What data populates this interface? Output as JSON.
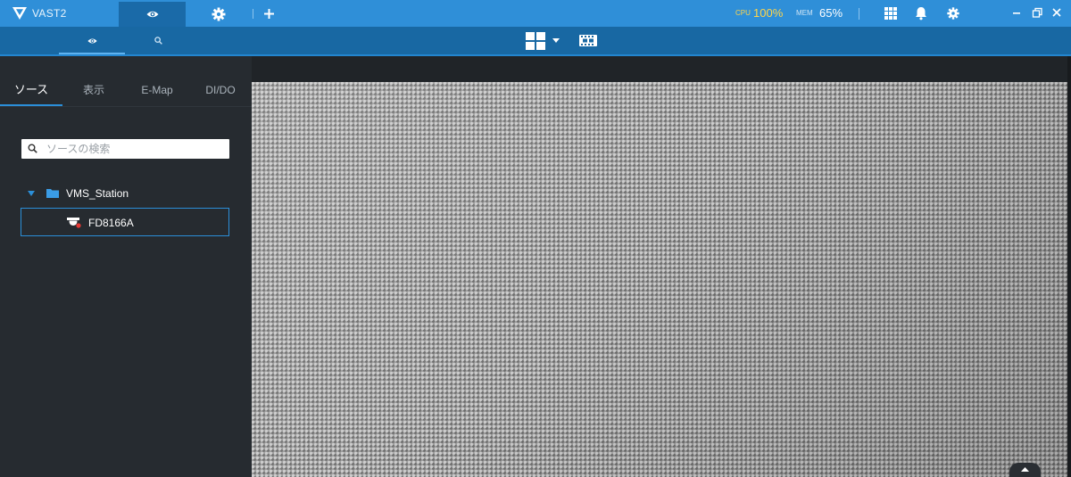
{
  "app": {
    "title": "VAST2"
  },
  "titlebar": {
    "tabs": [
      {
        "icon": "eye-icon",
        "active": true
      },
      {
        "icon": "gear-icon",
        "active": false
      }
    ],
    "add_tab_icon": "plus-icon",
    "stats": {
      "cpu_label": "CPU",
      "cpu_value": "100%",
      "mem_label": "MEM",
      "mem_value": "65%"
    },
    "right_icons": [
      "apps-grid-icon",
      "bell-icon",
      "gear-icon"
    ],
    "window_controls": [
      "minimize-icon",
      "restore-icon",
      "close-icon"
    ]
  },
  "subbar": {
    "tabs": [
      {
        "icon": "eye-icon",
        "active": true
      },
      {
        "icon": "search-icon",
        "active": false
      }
    ],
    "layout_icon": "layout-2x2-icon",
    "filmstrip_icon": "filmstrip-icon"
  },
  "left_panel": {
    "tabs": [
      {
        "label": "ソース",
        "active": true
      },
      {
        "label": "表示",
        "active": false
      },
      {
        "label": "E-Map",
        "active": false
      },
      {
        "label": "DI/DO",
        "active": false
      }
    ],
    "search": {
      "placeholder": "ソースの検索",
      "value": ""
    },
    "tree": {
      "station": {
        "label": "VMS_Station",
        "expanded": true
      },
      "devices": [
        {
          "label": "FD8166A",
          "status": "offline",
          "selected": true
        }
      ]
    }
  },
  "colors": {
    "titlebar": "#2f8fd8",
    "subbar": "#1868a3",
    "accent": "#2b8fd9",
    "cpu_warning": "#ffd54a",
    "panel_bg": "#262b30",
    "status_dot": "#e53935"
  }
}
